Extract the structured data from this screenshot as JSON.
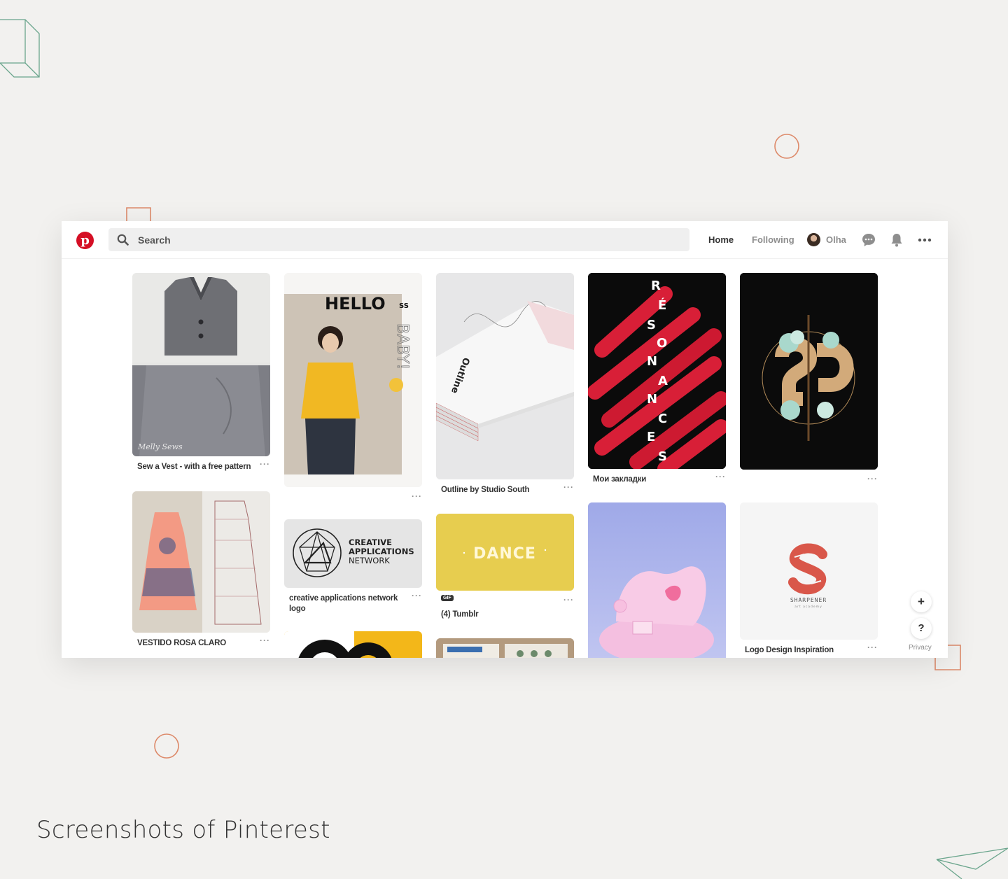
{
  "caption": "Screenshots of Pinterest",
  "header": {
    "logo_letter": "p",
    "search_placeholder": "Search",
    "nav_home": "Home",
    "nav_following": "Following",
    "user_name": "Olha"
  },
  "colors": {
    "brand_red": "#d50f25",
    "deco_orange": "#dd8a6a",
    "deco_green": "#6aa58c"
  },
  "pins": {
    "vest_title": "Sew a Vest - with a free pattern",
    "vest_watermark": "Melly Sews",
    "hello_title": "HELLO",
    "hello_ss": "SS",
    "hello_vertical": "BABY!",
    "outline_title": "Outline by Studio South",
    "outline_book_text": "Outline",
    "resonances_title": "Мои закладки",
    "resonances_letters": [
      "R",
      "É",
      "S",
      "O",
      "N",
      "A",
      "N",
      "C",
      "E",
      "S"
    ],
    "dress_title": "VESTIDO ROSA CLARO",
    "can_title": "creative applications network logo",
    "can_logo_lines": [
      "CREATIVE",
      "APPLICATIONS",
      "NETWORK"
    ],
    "dance_title": "(4) Tumblr",
    "dance_text": "DANCE",
    "gif_badge": "GIF",
    "logo_title": "Logo Design Inspiration",
    "sharpener_text": "SHARPENER",
    "sharpener_sub": "art academy",
    "dots": "···"
  },
  "fab": {
    "plus": "+",
    "help": "?",
    "privacy": "Privacy"
  }
}
